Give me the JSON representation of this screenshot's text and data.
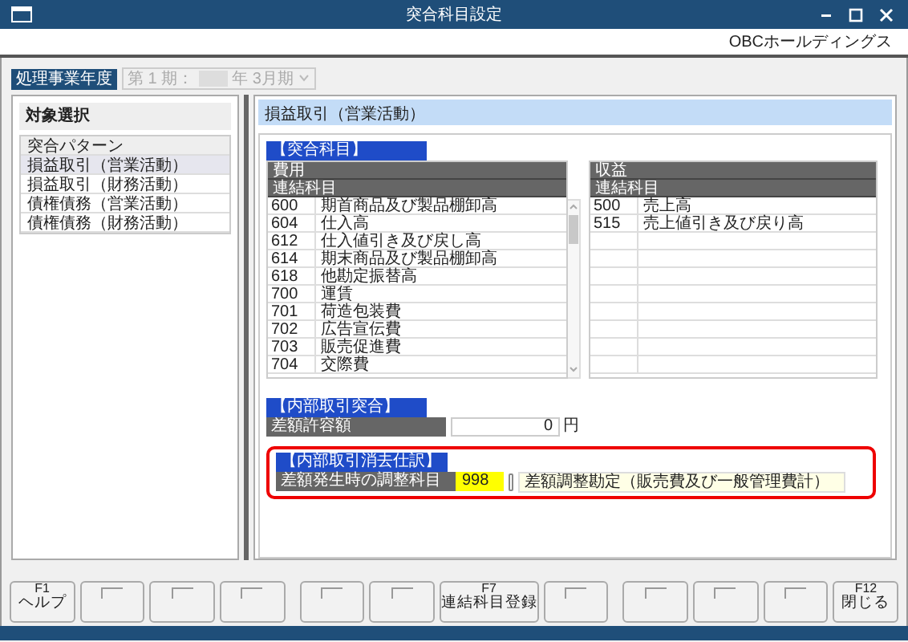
{
  "window": {
    "title": "突合科目設定"
  },
  "company": "OBCホールディングス",
  "fiscal_year": {
    "label": "処理事業年度",
    "prefix": "第 1 期：",
    "year_suffix": "年",
    "period": "3月期",
    "disabled": true
  },
  "target_selection": {
    "title": "対象選択",
    "header": "突合パターン",
    "items": [
      {
        "label": "損益取引（営業活動）",
        "selected": true
      },
      {
        "label": "損益取引（財務活動）",
        "selected": false
      },
      {
        "label": "債権債務（営業活動）",
        "selected": false
      },
      {
        "label": "債権債務（財務活動）",
        "selected": false
      }
    ]
  },
  "detail": {
    "title": "損益取引（営業活動）",
    "matching_accounts": {
      "title": "【突合科目】",
      "expense": {
        "title": "費用",
        "column": "連結科目",
        "rows": [
          {
            "code": "600",
            "name": "期首商品及び製品棚卸高"
          },
          {
            "code": "604",
            "name": "仕入高"
          },
          {
            "code": "612",
            "name": "仕入値引き及び戻し高"
          },
          {
            "code": "614",
            "name": "期末商品及び製品棚卸高"
          },
          {
            "code": "618",
            "name": "他勘定振替高"
          },
          {
            "code": "700",
            "name": "運賃"
          },
          {
            "code": "701",
            "name": "荷造包装費"
          },
          {
            "code": "702",
            "name": "広告宣伝費"
          },
          {
            "code": "703",
            "name": "販売促進費"
          },
          {
            "code": "704",
            "name": "交際費"
          }
        ]
      },
      "revenue": {
        "title": "収益",
        "column": "連結科目",
        "rows": [
          {
            "code": "500",
            "name": "売上高"
          },
          {
            "code": "515",
            "name": "売上値引き及び戻り高"
          }
        ]
      }
    },
    "internal_matching": {
      "title": "【内部取引突合】",
      "label": "差額許容額",
      "value": "0",
      "unit": "円"
    },
    "elimination": {
      "title": "【内部取引消去仕訳】",
      "label": "差額発生時の調整科目",
      "code": "998",
      "name": "差額調整勘定（販売費及び一般管理費計）",
      "highlighted": true
    }
  },
  "function_keys": [
    {
      "kind": "command",
      "key": "F1",
      "label": "ヘルプ"
    },
    {
      "kind": "blank"
    },
    {
      "kind": "blank"
    },
    {
      "kind": "blank"
    },
    {
      "kind": "blank"
    },
    {
      "kind": "blank"
    },
    {
      "kind": "command",
      "key": "F7",
      "label": "連結科目登録"
    },
    {
      "kind": "blank"
    },
    {
      "kind": "blank"
    },
    {
      "kind": "blank"
    },
    {
      "kind": "blank"
    },
    {
      "kind": "command",
      "key": "F12",
      "label": "閉じる"
    }
  ]
}
